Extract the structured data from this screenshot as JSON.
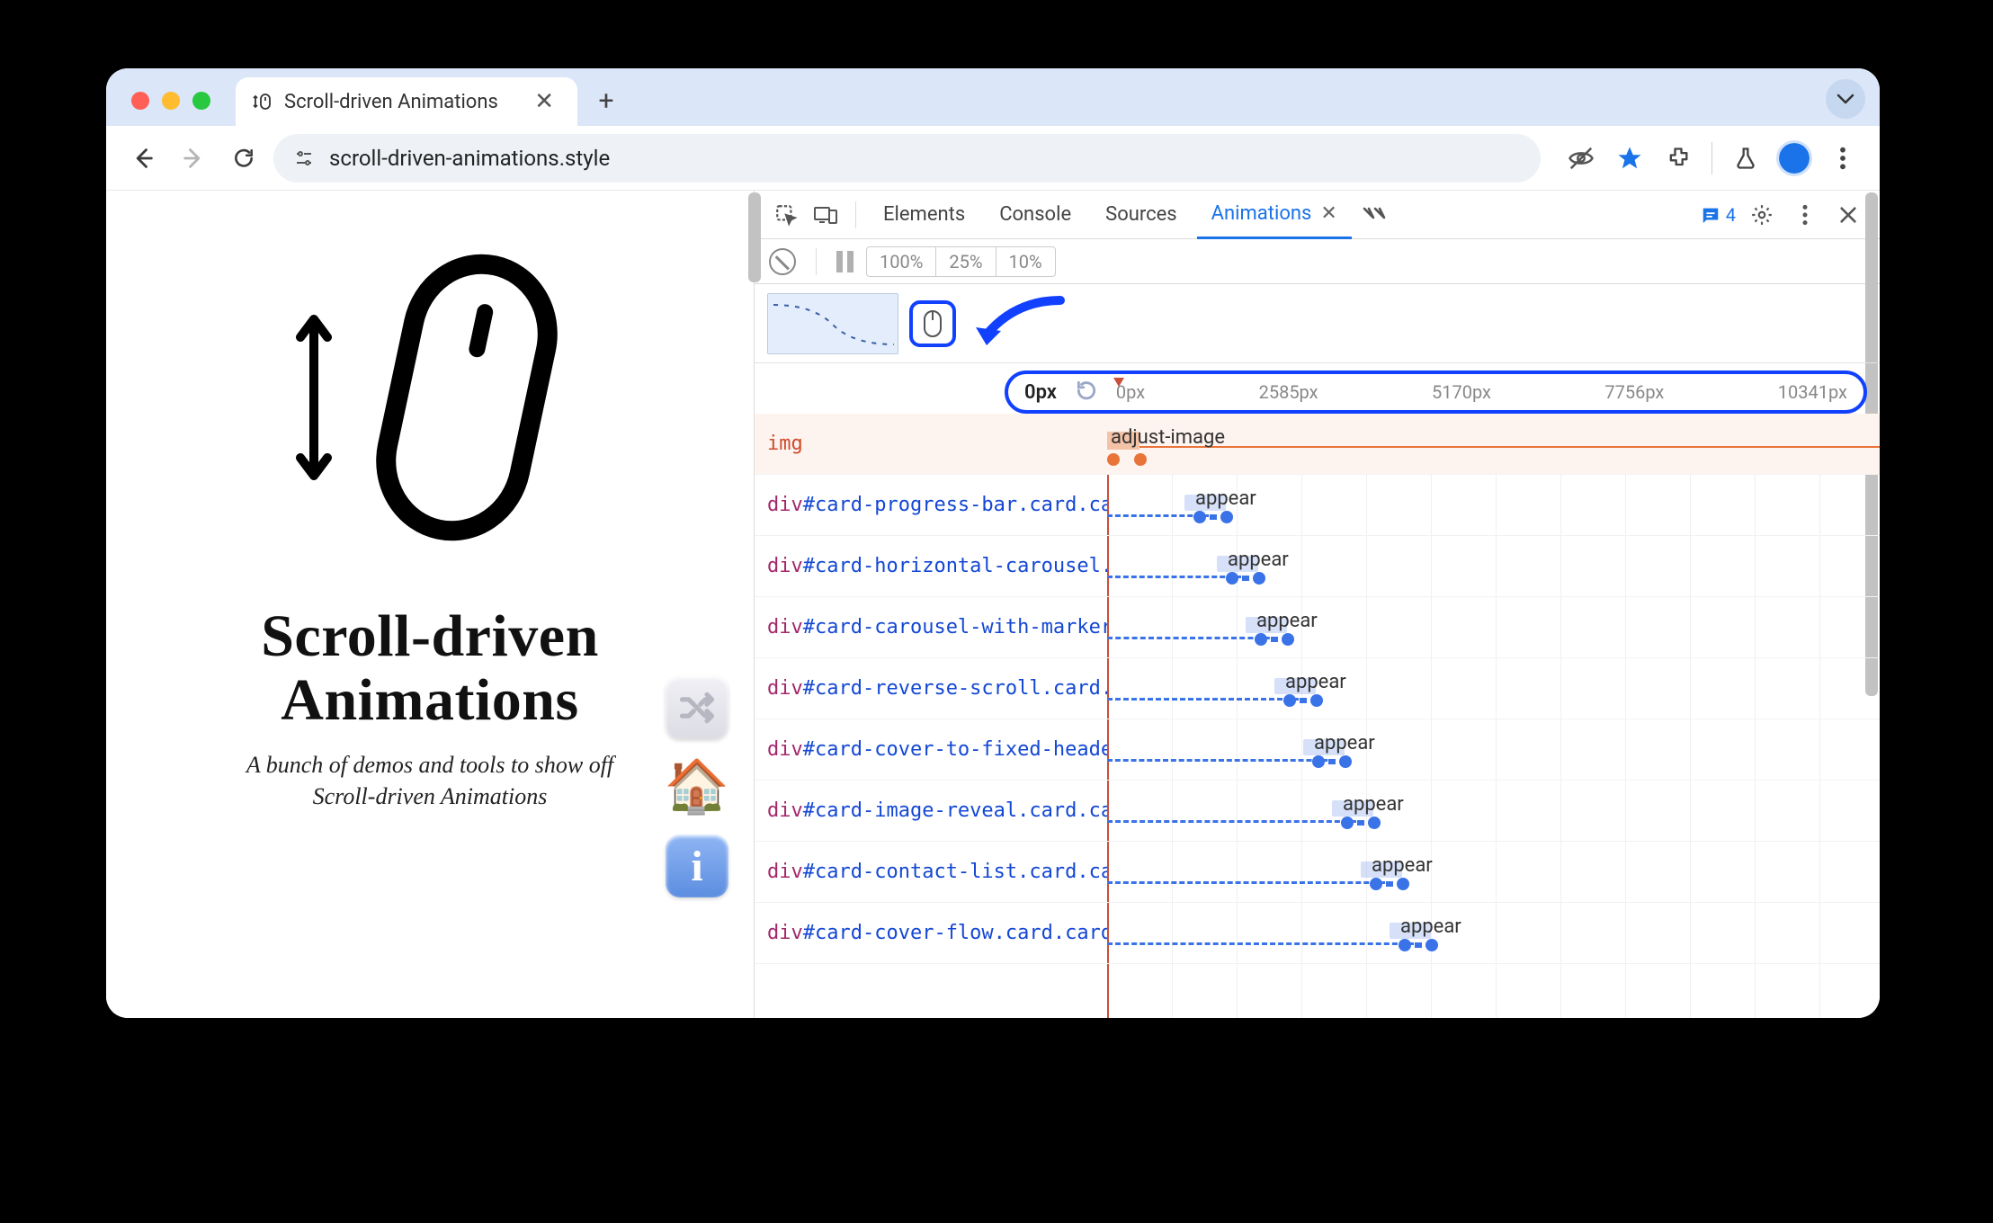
{
  "browser": {
    "tab_title": "Scroll-driven Animations",
    "url": "scroll-driven-animations.style"
  },
  "page": {
    "heading_l1": "Scroll-driven",
    "heading_l2": "Animations",
    "subtitle_l1": "A bunch of demos and tools to show off",
    "subtitle_l2": "Scroll-driven Animations"
  },
  "devtools": {
    "tabs": {
      "elements": "Elements",
      "console": "Console",
      "sources": "Sources",
      "animations": "Animations"
    },
    "issues_count": "4",
    "speed": {
      "s100": "100%",
      "s25": "25%",
      "s10": "10%"
    },
    "ruler": {
      "current": "0px",
      "ticks": [
        "0px",
        "2585px",
        "5170px",
        "7756px",
        "10341px"
      ]
    },
    "rows": [
      {
        "selector_tag": "img",
        "selector_rest": "",
        "label": "adjust-image",
        "offset": 0,
        "type": "orange"
      },
      {
        "selector_tag": "div",
        "selector_rest": "#card-progress-bar.card.ca",
        "label": "appear",
        "offset": 96
      },
      {
        "selector_tag": "div",
        "selector_rest": "#card-horizontal-carousel.",
        "label": "appear",
        "offset": 132
      },
      {
        "selector_tag": "div",
        "selector_rest": "#card-carousel-with-marker",
        "label": "appear",
        "offset": 164
      },
      {
        "selector_tag": "div",
        "selector_rest": "#card-reverse-scroll.card.",
        "label": "appear",
        "offset": 196
      },
      {
        "selector_tag": "div",
        "selector_rest": "#card-cover-to-fixed-heade",
        "label": "appear",
        "offset": 228
      },
      {
        "selector_tag": "div",
        "selector_rest": "#card-image-reveal.card.ca",
        "label": "appear",
        "offset": 260
      },
      {
        "selector_tag": "div",
        "selector_rest": "#card-contact-list.card.ca",
        "label": "appear",
        "offset": 292
      },
      {
        "selector_tag": "div",
        "selector_rest": "#card-cover-flow.card.card",
        "label": "appear",
        "offset": 324
      }
    ]
  }
}
